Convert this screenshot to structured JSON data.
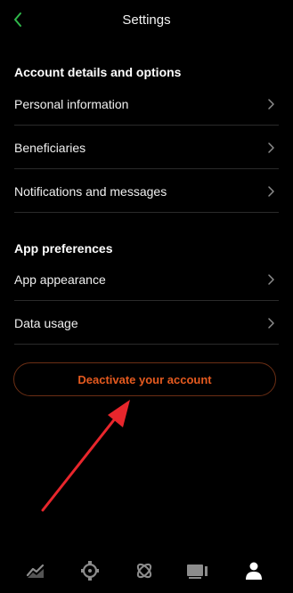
{
  "header": {
    "title": "Settings",
    "back_icon": "chevron-left-icon"
  },
  "colors": {
    "background": "#000000",
    "accent_green": "#2fb84a",
    "danger_orange": "#e55a1f",
    "danger_border": "#6b2e14",
    "arrow_red": "#e8262c",
    "divider": "#2a2a2a",
    "icon_gray": "#8c8c8c"
  },
  "account_section": {
    "title": "Account details and options",
    "items": [
      {
        "label": "Personal information"
      },
      {
        "label": "Beneficiaries"
      },
      {
        "label": "Notifications and messages"
      }
    ]
  },
  "app_section": {
    "title": "App preferences",
    "items": [
      {
        "label": "App appearance"
      },
      {
        "label": "Data usage"
      }
    ]
  },
  "deactivate": {
    "label": "Deactivate your account"
  },
  "tabbar": {
    "tabs": [
      {
        "icon": "chart-line-icon",
        "active": false
      },
      {
        "icon": "gear-watch-icon",
        "active": false
      },
      {
        "icon": "orbit-icon",
        "active": false
      },
      {
        "icon": "cards-icon",
        "active": false
      },
      {
        "icon": "person-icon",
        "active": true
      }
    ]
  }
}
